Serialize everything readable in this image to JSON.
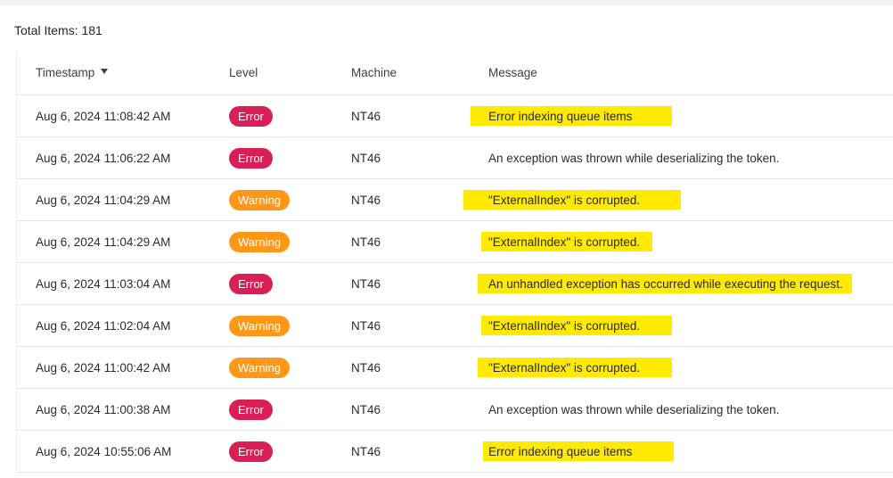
{
  "summary": {
    "total_items_label": "Total Items: 181"
  },
  "colors": {
    "error_badge": "#d91f55",
    "warning_badge": "#ff9818",
    "highlight": "#ffea00"
  },
  "table": {
    "columns": {
      "timestamp": "Timestamp",
      "level": "Level",
      "machine": "Machine",
      "message": "Message"
    },
    "sort": {
      "column": "timestamp",
      "direction": "descending",
      "icon": "caret-down-icon"
    },
    "rows": [
      {
        "timestamp": "Aug 6, 2024 11:08:42 AM",
        "level": "Error",
        "machine": "NT46",
        "message": "Error indexing queue items",
        "highlighted": true
      },
      {
        "timestamp": "Aug 6, 2024 11:06:22 AM",
        "level": "Error",
        "machine": "NT46",
        "message": "An exception was thrown while deserializing the token.",
        "highlighted": false
      },
      {
        "timestamp": "Aug 6, 2024 11:04:29 AM",
        "level": "Warning",
        "machine": "NT46",
        "message": "\"ExternalIndex\" is corrupted.",
        "highlighted": true
      },
      {
        "timestamp": "Aug 6, 2024 11:04:29 AM",
        "level": "Warning",
        "machine": "NT46",
        "message": "\"ExternalIndex\" is corrupted.",
        "highlighted": true
      },
      {
        "timestamp": "Aug 6, 2024 11:03:04 AM",
        "level": "Error",
        "machine": "NT46",
        "message": "An unhandled exception has occurred while executing the request.",
        "highlighted": true
      },
      {
        "timestamp": "Aug 6, 2024 11:02:04 AM",
        "level": "Warning",
        "machine": "NT46",
        "message": "\"ExternalIndex\" is corrupted.",
        "highlighted": true
      },
      {
        "timestamp": "Aug 6, 2024 11:00:42 AM",
        "level": "Warning",
        "machine": "NT46",
        "message": "\"ExternalIndex\" is corrupted.",
        "highlighted": true
      },
      {
        "timestamp": "Aug 6, 2024 11:00:38 AM",
        "level": "Error",
        "machine": "NT46",
        "message": "An exception was thrown while deserializing the token.",
        "highlighted": false
      },
      {
        "timestamp": "Aug 6, 2024 10:55:06 AM",
        "level": "Error",
        "machine": "NT46",
        "message": "Error indexing queue items",
        "highlighted": true
      }
    ]
  }
}
